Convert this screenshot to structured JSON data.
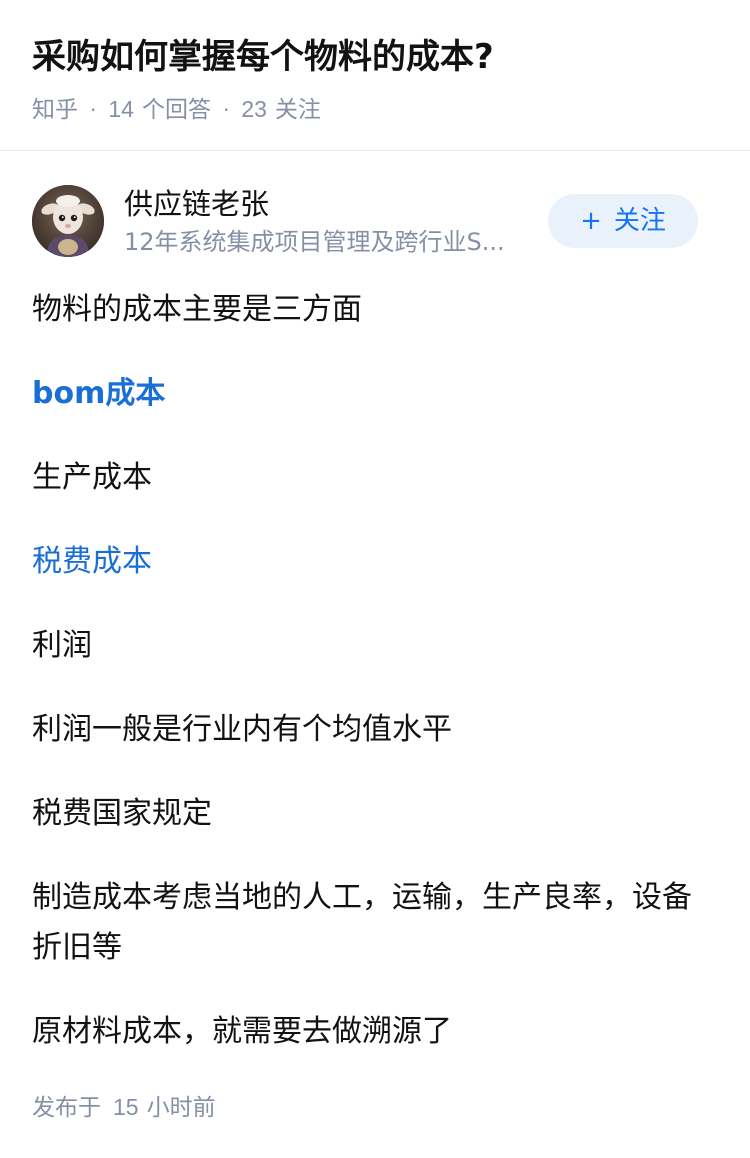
{
  "question": {
    "title": "采购如何掌握每个物料的成本?",
    "source": "知乎",
    "answer_count": "14",
    "answer_label": "个回答",
    "follower_count": "23",
    "follower_label": "关注"
  },
  "author": {
    "name": "供应链老张",
    "bio": "12年系统集成项目管理及跨行业S...",
    "follow_label": "关注",
    "follow_icon": "plus-icon"
  },
  "answer": {
    "paragraphs": [
      "物料的成本主要是三方面",
      "bom成本",
      "生产成本",
      "税费成本",
      "利润",
      "利润一般是行业内有个均值水平",
      "税费国家规定",
      "制造成本考虑当地的人工，运输，生产良率，设备折旧等",
      "原材料成本，就需要去做溯源了"
    ],
    "publish_prefix": "发布于",
    "publish_value": "15",
    "publish_unit": "小时前"
  },
  "colors": {
    "link": "#1a6fd6",
    "meta": "#8590a6",
    "follow_bg": "#e9f1fb",
    "follow_text": "#1772f6"
  }
}
